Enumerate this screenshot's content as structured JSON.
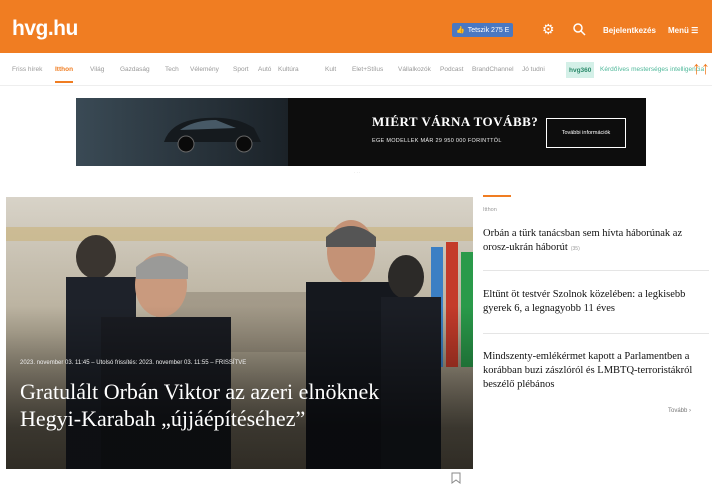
{
  "header": {
    "logo": "hvg.hu",
    "facebook_button": "Tetszik 275 E",
    "login": "Bejelentkezés",
    "menu": "Menü ☰",
    "brand_color": "#f07d22"
  },
  "nav": {
    "items": [
      {
        "label": "Friss hírek",
        "active": false
      },
      {
        "label": "Itthon",
        "active": true
      },
      {
        "label": "Világ",
        "active": false
      },
      {
        "label": "Gazdaság",
        "active": false
      },
      {
        "label": "Tech",
        "active": false
      },
      {
        "label": "Vélemény",
        "active": false
      },
      {
        "label": "Sport",
        "active": false
      },
      {
        "label": "Autó",
        "active": false
      },
      {
        "label": "Kultúra",
        "active": false
      },
      {
        "label": "Kult",
        "active": false
      },
      {
        "label": "Elet+Stílus",
        "active": false
      },
      {
        "label": "Vállalkozók",
        "active": false
      },
      {
        "label": "Podcast",
        "active": false
      },
      {
        "label": "BrandChannel",
        "active": false
      },
      {
        "label": "Jó tudni",
        "active": false
      }
    ],
    "hvg360": "hvg360",
    "promo": "Kérdőíves mesterséges intelligencia"
  },
  "ad": {
    "headline": "MIÉRT VÁRNA TOVÁBB?",
    "subline": "EGE MODELLEK MÁR 29 950 000 FORINTTÓL",
    "button": "További információk",
    "marker": "· · ·"
  },
  "hero": {
    "meta": "2023. november 03. 11:45  –  Utolsó frissítés: 2023. november 03. 11:55  –  FRISSÍTVE",
    "title": "Gratulált Orbán Viktor az azeri elnöknek Hegyi-Karabah „újjáépítéséhez”"
  },
  "sidebar": {
    "tag": "Itthon",
    "articles": [
      {
        "title": "Orbán a türk tanácsban sem hívta háborúnak az orosz-ukrán háborút",
        "count": "(35)"
      },
      {
        "title": "Eltűnt öt testvér Szolnok közelében: a legkisebb gyerek 6, a legnagyobb 11 éves",
        "count": ""
      },
      {
        "title": "Mindszenty-emlékérmet kapott a Parlamentben a korábban buzi zászlóról és LMBTQ-terroristákról beszélő plébános",
        "count": ""
      }
    ],
    "more": "Tovább ›"
  }
}
